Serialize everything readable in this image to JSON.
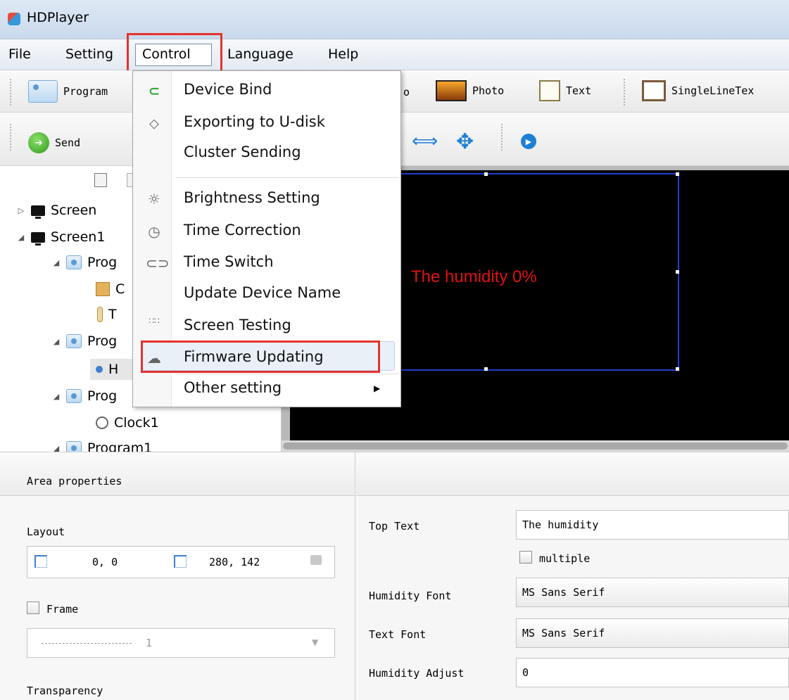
{
  "window": {
    "title": "HDPlayer"
  },
  "menubar": {
    "file": "File",
    "setting": "Setting",
    "control": "Control",
    "language": "Language",
    "help": "Help"
  },
  "toolbar1": {
    "program": "Program",
    "video_partial": "o",
    "photo": "Photo",
    "text": "Text",
    "singleline": "SingleLineTex"
  },
  "toolbar2": {
    "send": "Send"
  },
  "tree": {
    "items": [
      {
        "label": "Screen",
        "level": 0
      },
      {
        "label": "Screen1",
        "level": 0
      },
      {
        "label": "Prog",
        "level": 1
      },
      {
        "label": "C",
        "level": 2
      },
      {
        "label": "T",
        "level": 2
      },
      {
        "label": "Prog",
        "level": 1
      },
      {
        "label": "H",
        "level": 2
      },
      {
        "label": "Prog",
        "level": 1
      },
      {
        "label": "Clock1",
        "level": 2
      },
      {
        "label": "Program1",
        "level": 1
      }
    ]
  },
  "preview": {
    "text": "The humidity 0%"
  },
  "control_menu": {
    "items": [
      {
        "label": "Device Bind",
        "icon": "link-icon"
      },
      {
        "label": "Exporting to U-disk",
        "icon": "usb-icon"
      },
      {
        "label": "Cluster Sending",
        "icon": ""
      },
      {
        "label": "Brightness Setting",
        "icon": "bulb-icon"
      },
      {
        "label": "Time Correction",
        "icon": "clock-icon"
      },
      {
        "label": "Time Switch",
        "icon": "toggle-icon"
      },
      {
        "label": "Update Device Name",
        "icon": ""
      },
      {
        "label": "Screen Testing",
        "icon": "grid-dots-icon"
      },
      {
        "label": "Firmware Updating",
        "icon": "cloud-icon"
      },
      {
        "label": "Other setting",
        "icon": ""
      }
    ]
  },
  "properties": {
    "header": "Area properties",
    "layout_label": "Layout",
    "position": "0, 0",
    "size": "280, 142",
    "frame_label": "Frame",
    "frame_value": "1",
    "transparency_label": "Transparency",
    "top_text_label": "Top Text",
    "top_text_value": "The humidity",
    "multiple_label": "multiple",
    "humidity_font_label": "Humidity Font",
    "humidity_font_value": "MS Sans Serif",
    "text_font_label": "Text Font",
    "text_font_value": "MS Sans Serif",
    "humidity_adjust_label": "Humidity Adjust",
    "humidity_adjust_value": "0"
  },
  "colors": {
    "highlight": "#e5322d",
    "canvas": "#000000",
    "preview_text": "#e01010",
    "area_border": "#1f3fd1"
  }
}
